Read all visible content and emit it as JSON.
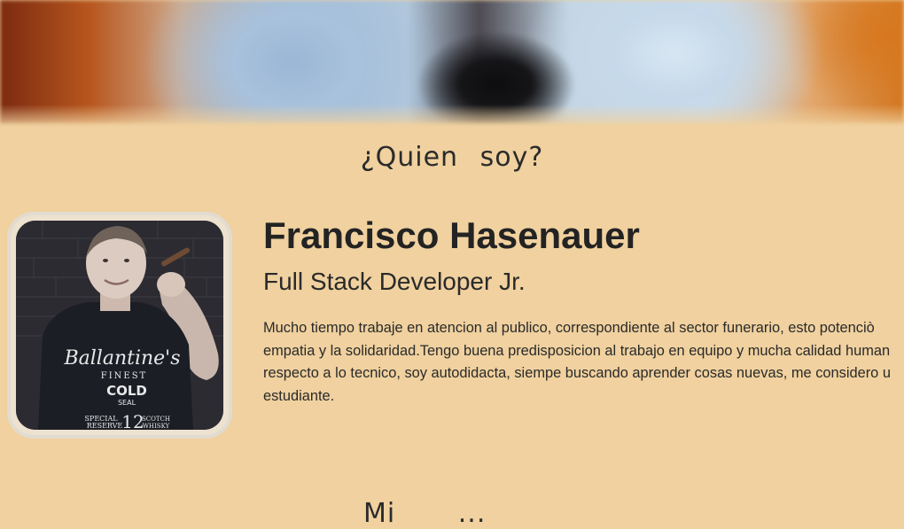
{
  "hero": {
    "image": "blurred-fox-face-banner"
  },
  "about": {
    "section_title": "¿Quien soy?",
    "name": "Francisco Hasenauer",
    "role": "Full Stack Developer Jr.",
    "bio_lines": [
      "Mucho tiempo trabaje en atencion al publico, correspondiente al sector funerario, esto potenciò",
      "empatia y la solidaridad.Tengo buena predisposicion al trabajo en equipo y mucha calidad human",
      "respecto a lo tecnico, soy autodidacta, siempe buscando aprender cosas nuevas, me considero u",
      "estudiante."
    ],
    "photo": {
      "description_icon": "profile-photo",
      "shirt_lines": [
        "Ballantine's",
        "FINEST",
        "COLD",
        "SEAL",
        "SPECIAL",
        "RESERVE",
        "12",
        "SCOTCH",
        "WHISKY"
      ]
    }
  },
  "next_section": {
    "title_partial": "Mi ..."
  },
  "colors": {
    "background": "#f0d19f",
    "text": "#232323",
    "frame": "#e2dbd0"
  }
}
